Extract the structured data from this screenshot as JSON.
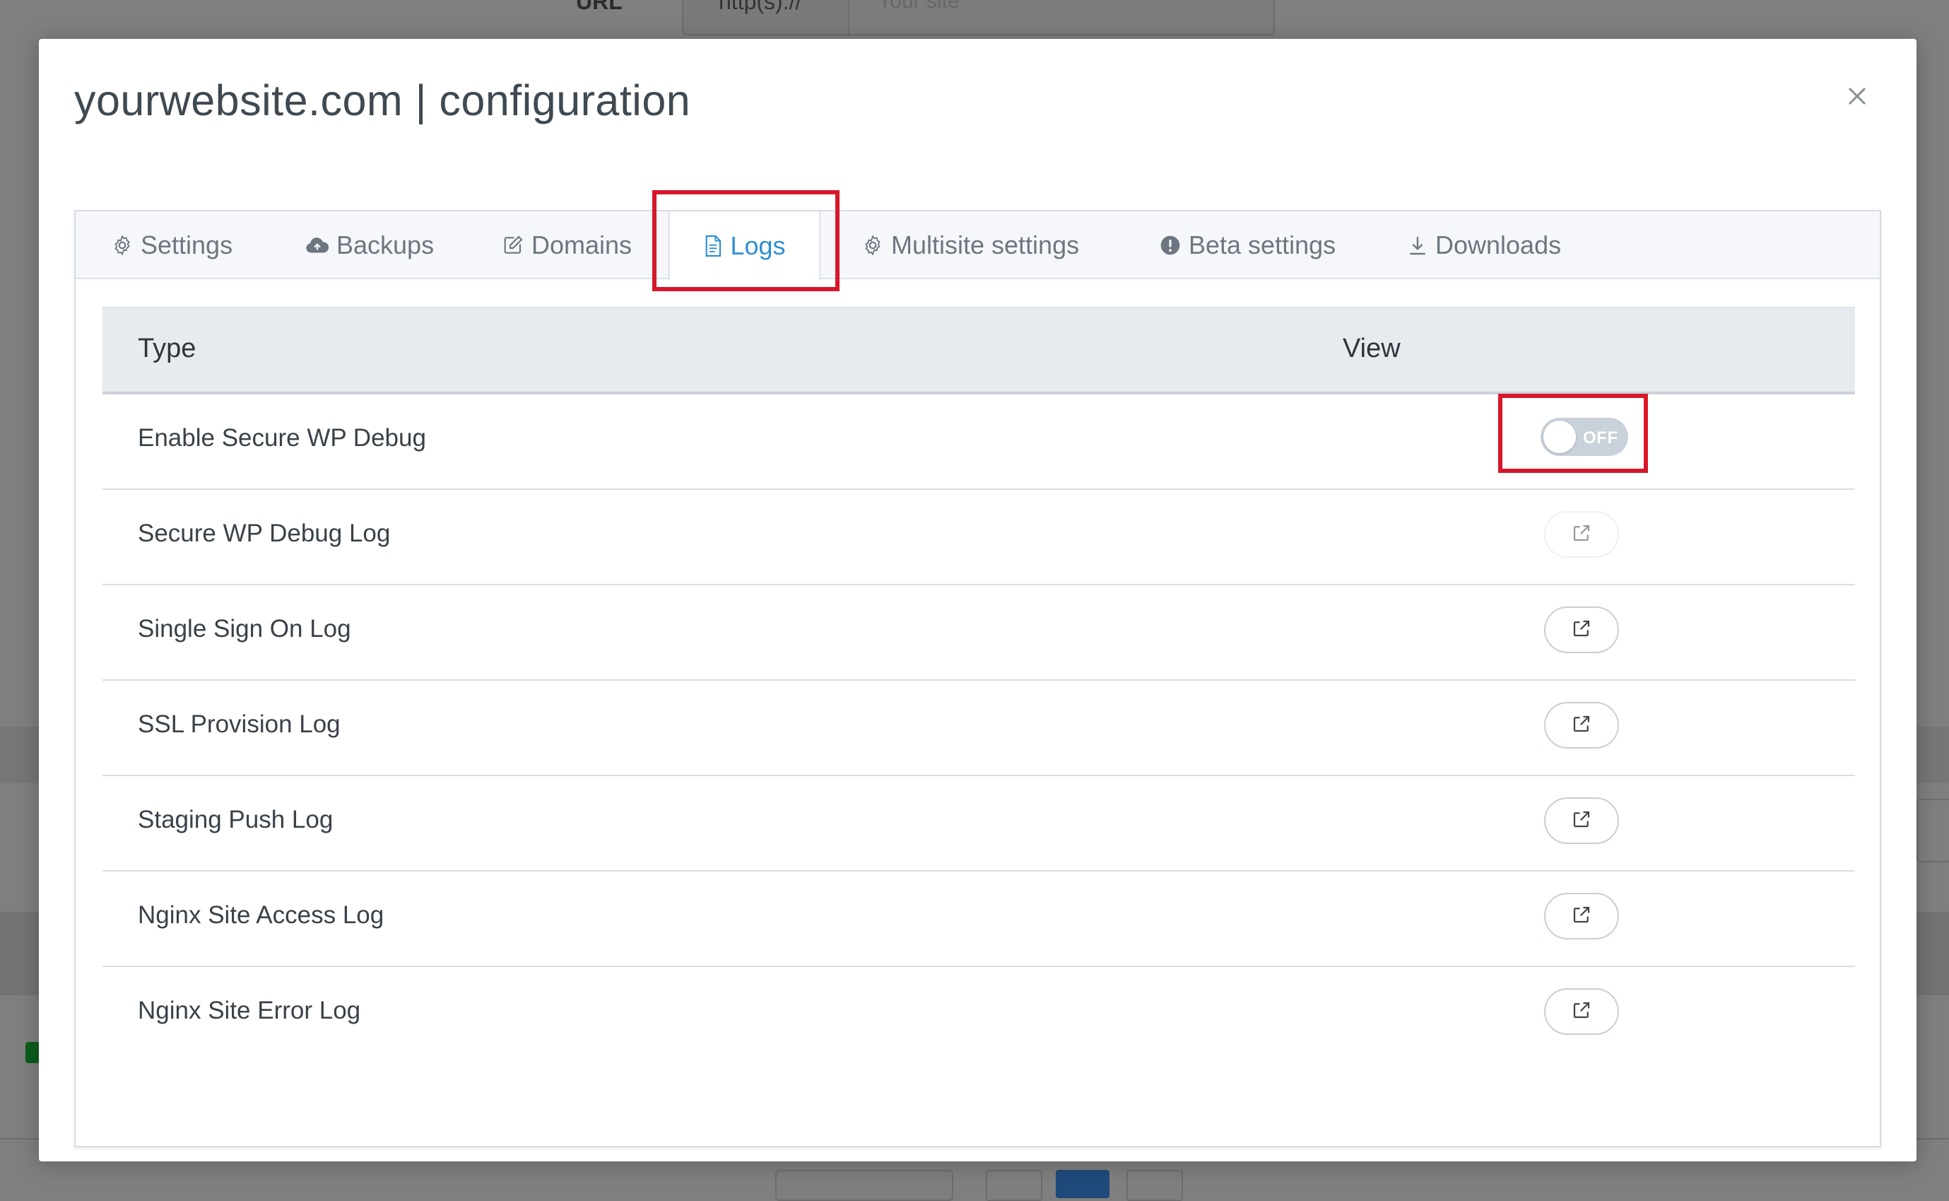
{
  "background": {
    "url_label": "URL",
    "url_prefix": "http(s)://",
    "site_placeholder": "Your site"
  },
  "modal": {
    "title": "yourwebsite.com | configuration",
    "close_icon": "close-icon"
  },
  "tabs": [
    {
      "label": "Settings",
      "icon": "gear-icon",
      "active": false
    },
    {
      "label": "Backups",
      "icon": "cloud-upload-icon",
      "active": false
    },
    {
      "label": "Domains",
      "icon": "edit-icon",
      "active": false
    },
    {
      "label": "Logs",
      "icon": "document-icon",
      "active": true
    },
    {
      "label": "Multisite settings",
      "icon": "gear-icon",
      "active": false
    },
    {
      "label": "Beta settings",
      "icon": "exclamation-circle-icon",
      "active": false
    },
    {
      "label": "Downloads",
      "icon": "download-icon",
      "active": false
    }
  ],
  "table": {
    "headers": {
      "type": "Type",
      "view": "View"
    },
    "rows": [
      {
        "label": "Enable Secure WP Debug",
        "control": "toggle",
        "toggle_text": "OFF",
        "enabled": false
      },
      {
        "label": "Secure WP Debug Log",
        "control": "button",
        "icon": "external-link-icon",
        "disabled": true
      },
      {
        "label": "Single Sign On Log",
        "control": "button",
        "icon": "external-link-icon",
        "disabled": false
      },
      {
        "label": "SSL Provision Log",
        "control": "button",
        "icon": "external-link-icon",
        "disabled": false
      },
      {
        "label": "Staging Push Log",
        "control": "button",
        "icon": "external-link-icon",
        "disabled": false
      },
      {
        "label": "Nginx Site Access Log",
        "control": "button",
        "icon": "external-link-icon",
        "disabled": false
      },
      {
        "label": "Nginx Site Error Log",
        "control": "button",
        "icon": "external-link-icon",
        "disabled": false
      }
    ]
  },
  "colors": {
    "active_tab": "#2d8fd5",
    "highlight": "#d7182a",
    "overlay": "#7f7f7f"
  }
}
